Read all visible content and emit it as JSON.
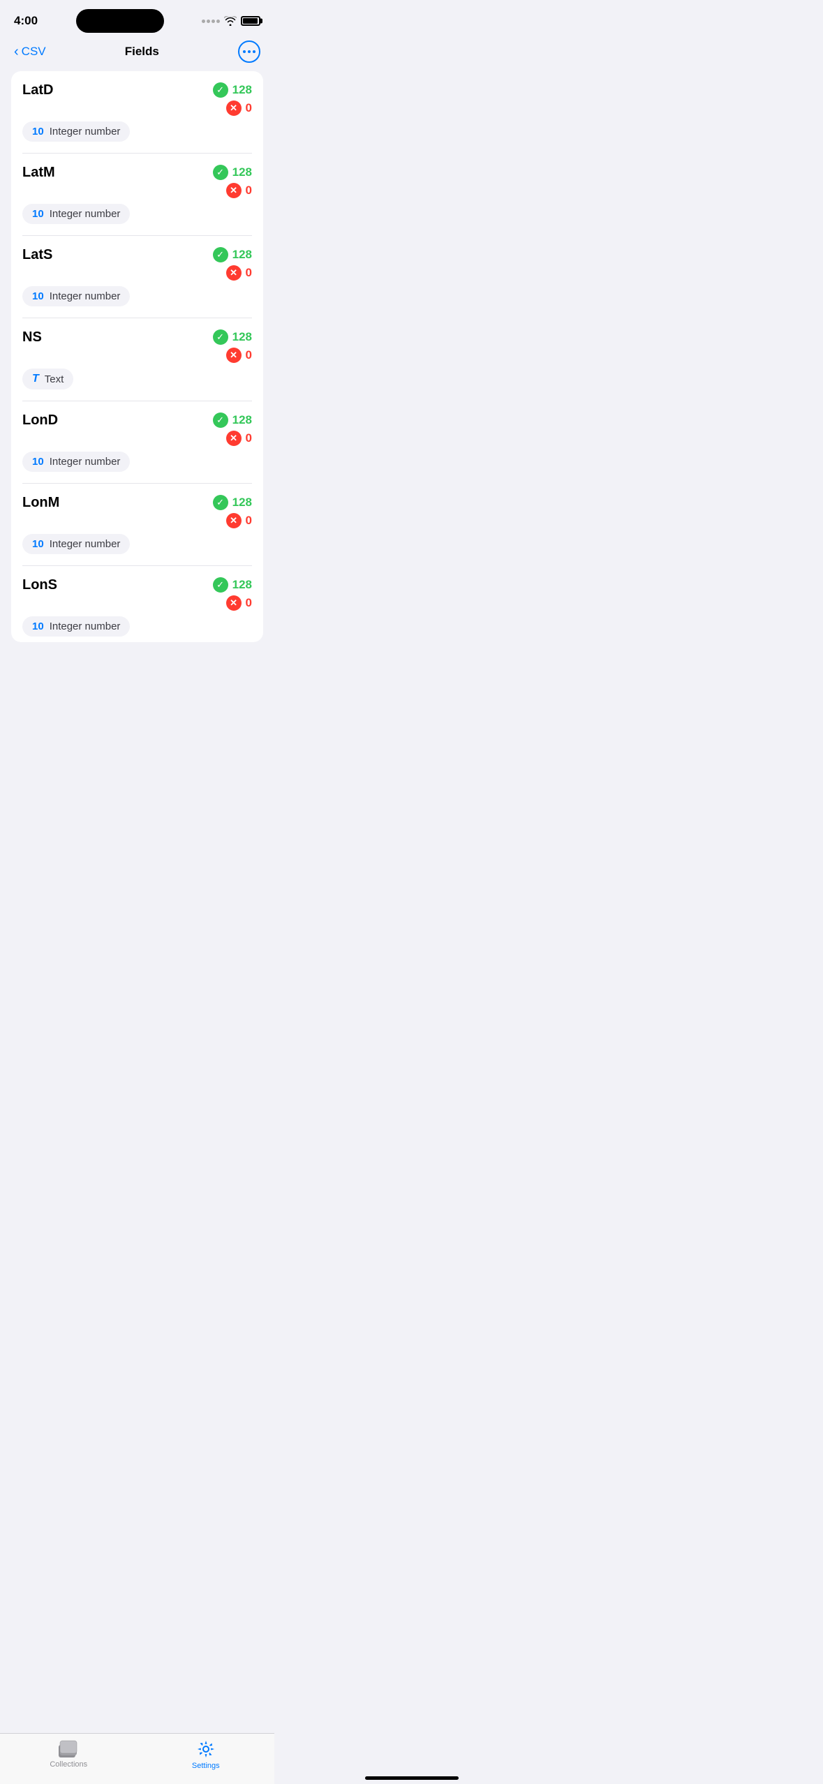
{
  "statusBar": {
    "time": "4:00"
  },
  "navBar": {
    "backLabel": "CSV",
    "title": "Fields"
  },
  "fields": [
    {
      "name": "LatD",
      "typeIcon": "number",
      "typeIconLabel": "10",
      "typeLabel": "Integer number",
      "countValid": "128",
      "countInvalid": "0"
    },
    {
      "name": "LatM",
      "typeIcon": "number",
      "typeIconLabel": "10",
      "typeLabel": "Integer number",
      "countValid": "128",
      "countInvalid": "0"
    },
    {
      "name": "LatS",
      "typeIcon": "number",
      "typeIconLabel": "10",
      "typeLabel": "Integer number",
      "countValid": "128",
      "countInvalid": "0"
    },
    {
      "name": "NS",
      "typeIcon": "text",
      "typeIconLabel": "T",
      "typeLabel": "Text",
      "countValid": "128",
      "countInvalid": "0"
    },
    {
      "name": "LonD",
      "typeIcon": "number",
      "typeIconLabel": "10",
      "typeLabel": "Integer number",
      "countValid": "128",
      "countInvalid": "0"
    },
    {
      "name": "LonM",
      "typeIcon": "number",
      "typeIconLabel": "10",
      "typeLabel": "Integer number",
      "countValid": "128",
      "countInvalid": "0"
    },
    {
      "name": "LonS",
      "typeIcon": "number",
      "typeIconLabel": "10",
      "typeLabel": "Integer number",
      "countValid": "128",
      "countInvalid": "0",
      "partial": true
    }
  ],
  "tabBar": {
    "collectionsLabel": "Collections",
    "settingsLabel": "Settings"
  }
}
